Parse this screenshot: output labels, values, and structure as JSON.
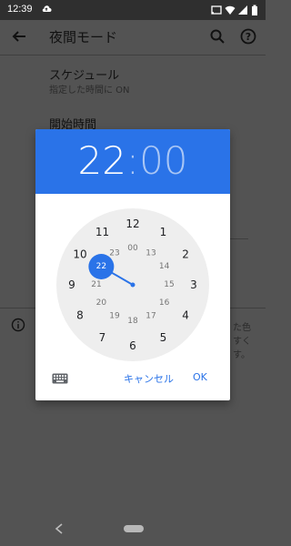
{
  "status_bar": {
    "time": "12:39",
    "icons": [
      "cloud-upload-icon",
      "cast-icon",
      "wifi-icon",
      "signal-icon",
      "battery-icon"
    ]
  },
  "app_bar": {
    "title": "夜間モード",
    "icons": [
      "back-arrow-icon",
      "search-icon",
      "help-icon"
    ]
  },
  "background": {
    "schedule_title": "スケジュール",
    "schedule_subtitle": "指定した時間に ON",
    "start_time_title": "開始時間",
    "info_tail_lines": [
      "た色",
      "すく",
      "す。"
    ]
  },
  "time_picker": {
    "hour": "22",
    "separator": ":",
    "minute": "00",
    "selected_hour": "22",
    "outer_hours": [
      "12",
      "1",
      "2",
      "3",
      "4",
      "5",
      "6",
      "7",
      "8",
      "9",
      "10",
      "11"
    ],
    "inner_hours": [
      "00",
      "13",
      "14",
      "15",
      "16",
      "17",
      "18",
      "19",
      "20",
      "21",
      "22",
      "23"
    ],
    "buttons": {
      "cancel": "キャンセル",
      "ok": "OK"
    },
    "keyboard_icon": "keyboard-icon"
  },
  "colors": {
    "accent": "#2a73e8",
    "dim_background": "#535353",
    "clock_face": "#eeeeee"
  },
  "nav_bar": {
    "icons": [
      "nav-back-icon",
      "nav-home-pill"
    ]
  }
}
